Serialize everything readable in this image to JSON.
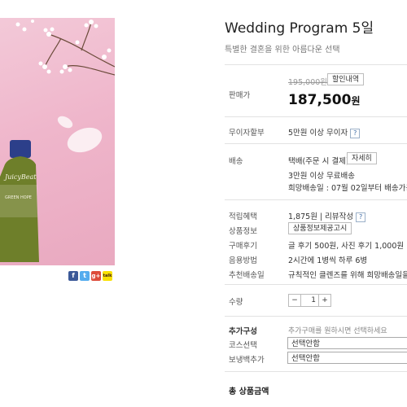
{
  "product": {
    "title": "Wedding Program 5일",
    "subtitle": "특별한 결혼을 위한 아름다운 선택",
    "bottle_text": "JuicyBeat",
    "bottle_sub": "GREEN HOPE"
  },
  "price": {
    "label": "판매가",
    "original": "195,000원",
    "discount_button": "할인내역",
    "final_amount": "187,500",
    "final_unit": "원"
  },
  "installment": {
    "label": "무이자할부",
    "value": "5만원 이상 무이자"
  },
  "shipping": {
    "label": "배송",
    "method": "택배(주문 시 결제)",
    "detail_button": "자세히",
    "line2": "3만원 이상 무료배송",
    "line3": "희망배송일 : 07월 02일부터 배송가능("
  },
  "info_rows": [
    {
      "label": "적립혜택",
      "value": "1,875원 | 리뷰작성"
    },
    {
      "label": "상품정보",
      "button": "상품정보제공고시"
    },
    {
      "label": "구매후기",
      "value": "글 후기 500원, 사진 후기 1,000원"
    },
    {
      "label": "음용방법",
      "value": "2시간에 1병씩 하루 6병"
    },
    {
      "label": "추천배송일",
      "value": "규칙적인 클렌즈를 위해 희망배송일을 "
    }
  ],
  "quantity": {
    "label": "수량",
    "minus": "−",
    "value": "1",
    "plus": "+"
  },
  "additional": {
    "label": "추가구성",
    "hint": "추가구매를 원하시면 선택하세요",
    "course_label": "코스선택",
    "course_value": "선택안함",
    "bag_label": "보냉백추가",
    "bag_value": "선택안함"
  },
  "total": {
    "label": "총 상품금액"
  },
  "social": [
    "f",
    "t",
    "g+",
    "talk"
  ],
  "colors": {
    "facebook": "#3b5998",
    "twitter": "#55acee",
    "google": "#dd4b39",
    "kakao": "#f9e000"
  }
}
